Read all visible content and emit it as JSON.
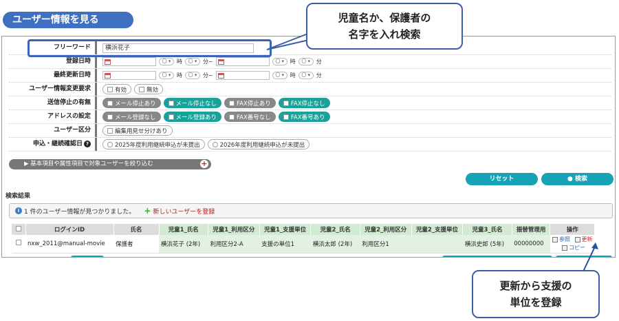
{
  "page": {
    "title": "ユーザー情報を見る"
  },
  "form": {
    "free_word": {
      "label": "フリーワード",
      "value": "横浜花子"
    },
    "registered": {
      "label": "登録日時"
    },
    "updated": {
      "label": "最終更新日時"
    },
    "time_units": {
      "hour": "時",
      "minute": "分",
      "range": "分~",
      "select": "〇 ▾"
    },
    "change_request": {
      "label": "ユーザー情報変更要求",
      "options": [
        "有効",
        "無効"
      ]
    },
    "send_stop": {
      "label": "送信停止の有無",
      "options": [
        "メール停止あり",
        "メール停止なし",
        "FAX停止あり",
        "FAX停止なし"
      ]
    },
    "address": {
      "label": "アドレスの設定",
      "options": [
        "メール登録なし",
        "メール登録あり",
        "FAX番号なし",
        "FAX番号あり"
      ]
    },
    "user_class": {
      "label": "ユーザー区分",
      "options": [
        "編集用見せ分けあり"
      ]
    },
    "application": {
      "label": "申込・継続確認日",
      "help": "?",
      "options": [
        "2025年度利用継続申込が未提出",
        "2026年度利用継続申込が未提出"
      ]
    },
    "expand": {
      "label": "▶ 基本項目や属性項目で対象ユーザーを絞り込む",
      "plus": "+"
    }
  },
  "buttons": {
    "reset": "リセット",
    "search": "● 検索"
  },
  "results": {
    "section_label": "検索結果",
    "info_icon": "i",
    "info_text": "1 件のユーザー情報が見つかりました。",
    "register_plus": "+",
    "register_link": "新しいユーザーを登録",
    "columns": [
      "ログインID",
      "氏名",
      "児童1_氏名",
      "児童1_利用区分",
      "児童1_支援単位",
      "児童2_氏名",
      "児童2_利用区分",
      "児童2_支援単位",
      "児童3_氏名",
      "振替管理用",
      "操作"
    ],
    "rows": [
      {
        "login": "nxw_2011@manual-movie",
        "name": "保護者",
        "c1_name": "横浜花子 (2年)",
        "c1_class": "利用区分2-A",
        "c1_unit": "支援の単位1",
        "c2_name": "横浜太郎 (2年)",
        "c2_class": "利用区分1",
        "c2_unit": "",
        "c3_name": "横浜史郎 (5年)",
        "transfer": "00000000",
        "op_view": "参照",
        "op_update": "更新",
        "op_copy": "コピー"
      }
    ]
  },
  "callouts": {
    "top": [
      "児童名か、保護者の",
      "名字を入れ検索"
    ],
    "bottom": [
      "更新から支援の",
      "単位を登録"
    ]
  },
  "colors": {
    "title_pill": "#3f6fc0",
    "teal": "#18a29a",
    "button": "#18a2b5",
    "callout_border": "#3a5ea8"
  }
}
